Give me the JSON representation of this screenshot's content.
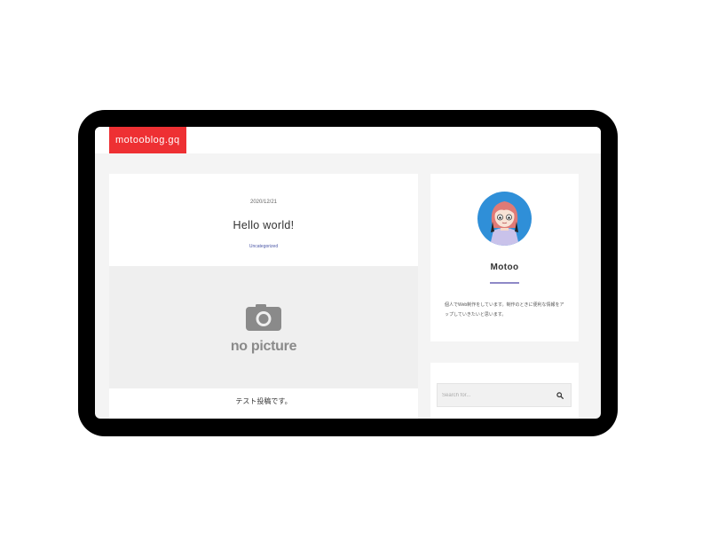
{
  "site": {
    "logo": "motooblog.gq"
  },
  "post": {
    "date": "2020/12/21",
    "title": "Hello world!",
    "category": "Uncategorized",
    "thumbnail_text": "no picture",
    "excerpt": "テスト投稿です。"
  },
  "profile": {
    "name": "Motoo",
    "bio": "個人でWeb制作をしています。制作のときに便利な情報をアップしていきたいと思います。"
  },
  "search": {
    "placeholder": "Search for..."
  },
  "colors": {
    "brand": "#ee3033",
    "accent": "#8e89c7",
    "link": "#4a56a6"
  }
}
